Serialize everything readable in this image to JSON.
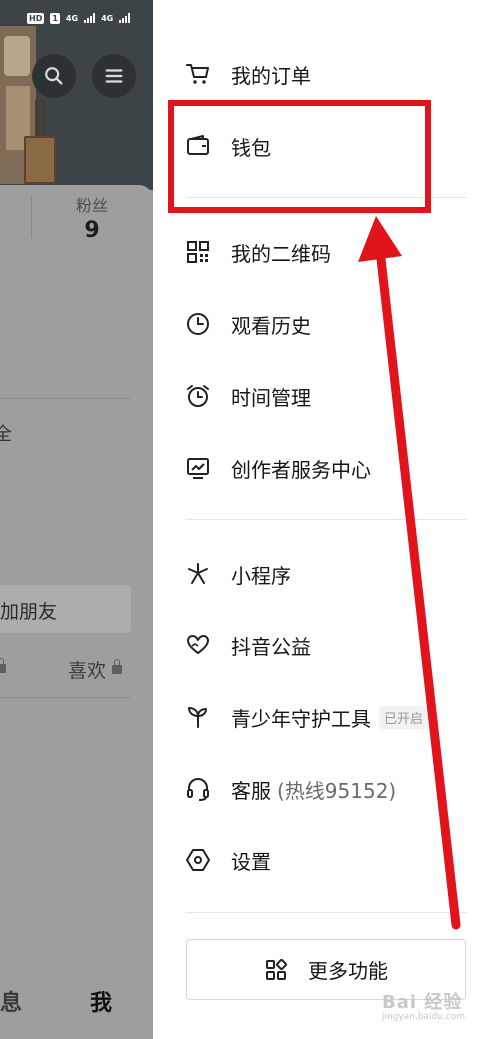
{
  "status_bar": {
    "hd_badge": "HD",
    "sim_badge": "1",
    "net1": "4G",
    "net2": "4G"
  },
  "profile": {
    "fans_label": "粉丝",
    "fans_count": "9",
    "partial_text": "全",
    "add_friend": "加朋友",
    "likes_label": "喜欢",
    "bottom_nav_partial": "消息",
    "bottom_nav_me": "我"
  },
  "drawer": {
    "group1": [
      {
        "label": "我的订单",
        "icon": "cart-icon"
      },
      {
        "label": "钱包",
        "icon": "wallet-icon"
      }
    ],
    "group2": [
      {
        "label": "我的二维码",
        "icon": "qr-code-icon"
      },
      {
        "label": "观看历史",
        "icon": "clock-icon"
      },
      {
        "label": "时间管理",
        "icon": "alarm-clock-icon"
      },
      {
        "label": "创作者服务中心",
        "icon": "chart-monitor-icon"
      }
    ],
    "group3": [
      {
        "label": "小程序",
        "icon": "mini-program-icon"
      },
      {
        "label": "抖音公益",
        "icon": "heart-hands-icon"
      },
      {
        "label": "青少年守护工具",
        "icon": "sprout-icon",
        "badge": "已开启"
      },
      {
        "label": "客服",
        "label_suffix": "(热线95152)",
        "icon": "headset-icon"
      },
      {
        "label": "设置",
        "icon": "settings-hexagon-icon"
      }
    ],
    "more_button": "更多功能"
  },
  "watermark": {
    "text": "Bai 经验",
    "sub": "jingyan.baidu.com"
  },
  "colors": {
    "annotation_red": "#e0141a",
    "dim_overlay": "#9e9e9e"
  }
}
